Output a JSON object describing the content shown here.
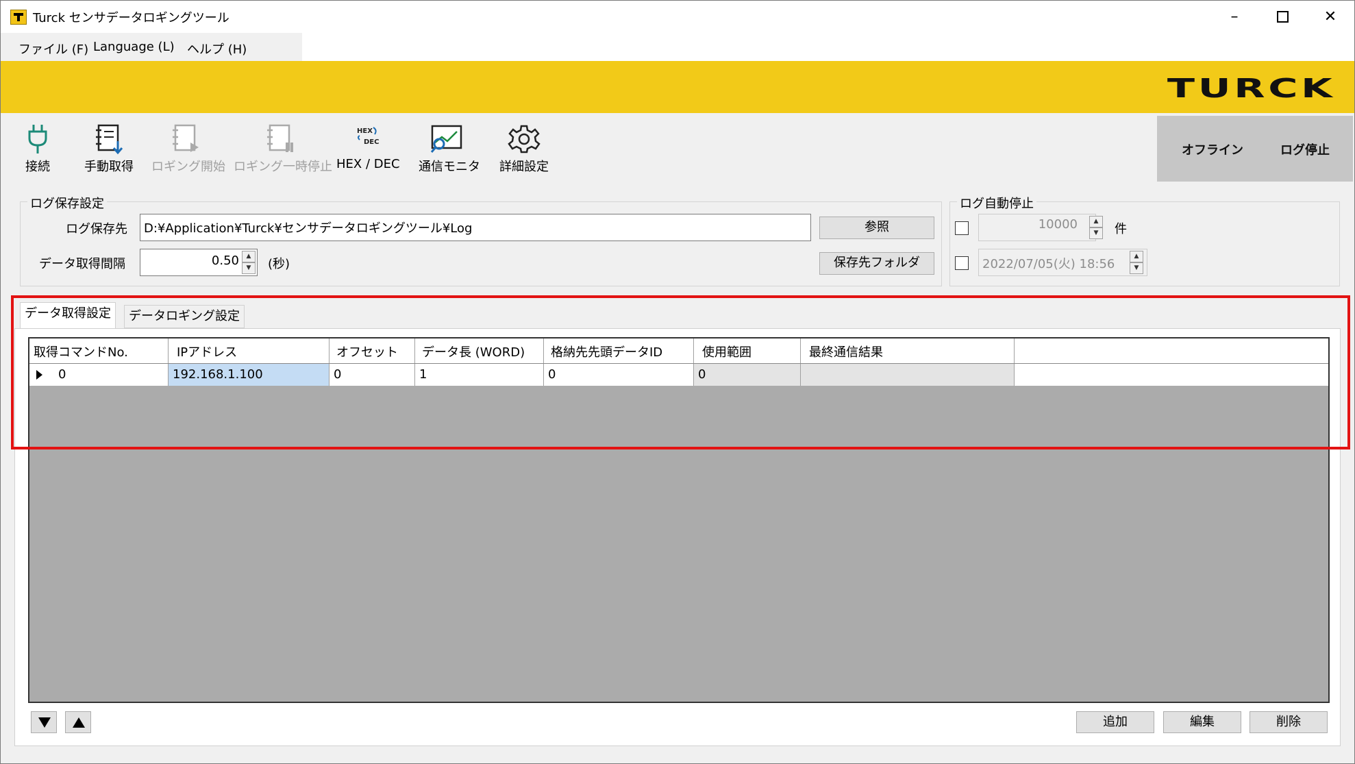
{
  "window": {
    "title": "Turck センサデータロギングツール",
    "minimize": "–",
    "close": "✕"
  },
  "menu": [
    "ファイル (F)",
    "Language (L)",
    "ヘルプ (H)"
  ],
  "brand": {
    "logo": "TURCK",
    "color": "#f2ca18"
  },
  "toolbar": {
    "connect": "接続",
    "manual_acquire": "手動取得",
    "logging_start": "ロギング開始",
    "logging_pause": "ロギング一時停止",
    "hex_dec": "HEX / DEC",
    "comm_monitor": "通信モニタ",
    "advanced_settings": "詳細設定",
    "hex_icon_top": "HEX",
    "hex_icon_bottom": "DEC"
  },
  "status": {
    "connection": "オフライン",
    "logging": "ログ停止"
  },
  "log_save": {
    "group_title": "ログ保存設定",
    "path_label": "ログ保存先",
    "path_value": "D:¥Application¥Turck¥センサデータロギングツール¥Log",
    "browse_button": "参照",
    "interval_label": "データ取得間隔",
    "interval_value": "0.50",
    "interval_unit": "(秒)",
    "folder_button": "保存先フォルダ"
  },
  "auto_stop": {
    "group_title": "ログ自動停止",
    "count_value": "10000",
    "count_unit": "件",
    "datetime_value": "2022/07/05(火) 18:56"
  },
  "tabs": [
    "データ取得設定",
    "データロギング設定"
  ],
  "grid": {
    "columns": [
      "取得コマンドNo.",
      "IPアドレス",
      "オフセット",
      "データ長 (WORD)",
      "格納先先頭データID",
      "使用範囲",
      "最終通信結果"
    ],
    "rows": [
      [
        "0",
        "192.168.1.100",
        "0",
        "1",
        "0",
        "0",
        ""
      ]
    ]
  },
  "actions": {
    "add": "追加",
    "edit": "編集",
    "delete": "削除"
  },
  "annotation_color": "#e31313"
}
